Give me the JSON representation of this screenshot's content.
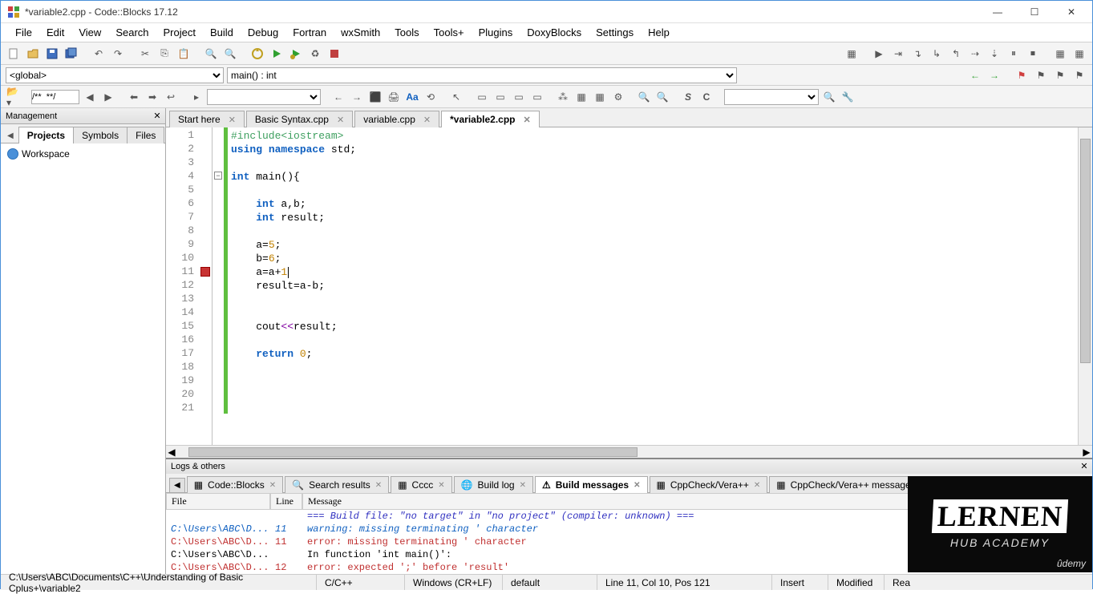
{
  "window": {
    "title": "*variable2.cpp - Code::Blocks 17.12"
  },
  "menu": [
    "File",
    "Edit",
    "View",
    "Search",
    "Project",
    "Build",
    "Debug",
    "Fortran",
    "wxSmith",
    "Tools",
    "Tools+",
    "Plugins",
    "DoxyBlocks",
    "Settings",
    "Help"
  ],
  "scope_combo": "<global>",
  "func_combo": "main() : int",
  "search_box2": "/**  **/",
  "management": {
    "title": "Management",
    "tabs": [
      "Projects",
      "Symbols",
      "Files"
    ],
    "active_tab": 0,
    "workspace": "Workspace"
  },
  "editor_tabs": [
    {
      "label": "Start here",
      "modified": false,
      "active": false
    },
    {
      "label": "Basic Syntax.cpp",
      "modified": false,
      "active": false
    },
    {
      "label": "variable.cpp",
      "modified": false,
      "active": false
    },
    {
      "label": "*variable2.cpp",
      "modified": true,
      "active": true
    }
  ],
  "code": {
    "lines": [
      {
        "n": 1,
        "html": "<span class='kw-pre'>#include&lt;iostream&gt;</span>"
      },
      {
        "n": 2,
        "html": "<span class='kw-blue'>using</span> <span class='kw-blue'>namespace</span> std;"
      },
      {
        "n": 3,
        "html": ""
      },
      {
        "n": 4,
        "html": "<span class='kw-blue'>int</span> main(){",
        "fold": true
      },
      {
        "n": 5,
        "html": ""
      },
      {
        "n": 6,
        "html": "    <span class='kw-blue'>int</span> a,b;"
      },
      {
        "n": 7,
        "html": "    <span class='kw-blue'>int</span> result;"
      },
      {
        "n": 8,
        "html": ""
      },
      {
        "n": 9,
        "html": "    a=<span class='num'>5</span>;"
      },
      {
        "n": 10,
        "html": "    b=<span class='num'>6</span>;"
      },
      {
        "n": 11,
        "html": "    a=a+<span class='num'>1</span><span class='text-cursor'></span>",
        "bp": true,
        "cursor": true
      },
      {
        "n": 12,
        "html": "    result=a-b;"
      },
      {
        "n": 13,
        "html": ""
      },
      {
        "n": 14,
        "html": ""
      },
      {
        "n": 15,
        "html": "    cout<span class='kw-purple'>&lt;&lt;</span>result;"
      },
      {
        "n": 16,
        "html": ""
      },
      {
        "n": 17,
        "html": "    <span class='kw-blue'>return</span> <span class='num'>0</span>;"
      },
      {
        "n": 18,
        "html": ""
      },
      {
        "n": 19,
        "html": ""
      },
      {
        "n": 20,
        "html": ""
      },
      {
        "n": 21,
        "html": ""
      }
    ]
  },
  "logs": {
    "title": "Logs & others",
    "tabs": [
      "Code::Blocks",
      "Search results",
      "Cccc",
      "Build log",
      "Build messages",
      "CppCheck/Vera++",
      "CppCheck/Vera++ messages"
    ],
    "active": 4,
    "headers": [
      "File",
      "Line",
      "Message"
    ],
    "rows": [
      {
        "file": "",
        "line": "",
        "msg": "=== Build file: \"no target\" in \"no project\" (compiler: unknown) ===",
        "cls": "msg-info"
      },
      {
        "file": "C:\\Users\\ABC\\D...",
        "line": "11",
        "msg": "warning: missing terminating ' character",
        "cls": "msg-warn"
      },
      {
        "file": "C:\\Users\\ABC\\D...",
        "line": "11",
        "msg": "error: missing terminating ' character",
        "cls": "msg-err"
      },
      {
        "file": "C:\\Users\\ABC\\D...",
        "line": "",
        "msg": "In function 'int main()':",
        "cls": ""
      },
      {
        "file": "C:\\Users\\ABC\\D...",
        "line": "12",
        "msg": "error: expected ';' before 'result'",
        "cls": "msg-err"
      }
    ]
  },
  "status": {
    "path": "C:\\Users\\ABC\\Documents\\C++\\Understanding of Basic Cplus+\\variable2",
    "lang": "C/C++",
    "eol": "Windows (CR+LF)",
    "enc": "default",
    "pos": "Line 11, Col 10, Pos 121",
    "insert": "Insert",
    "mod": "Modified",
    "rw": "Rea"
  },
  "overlay": {
    "brand": "LERNEN",
    "sub": "HUB ACADEMY",
    "udemy": "ûdemy"
  }
}
